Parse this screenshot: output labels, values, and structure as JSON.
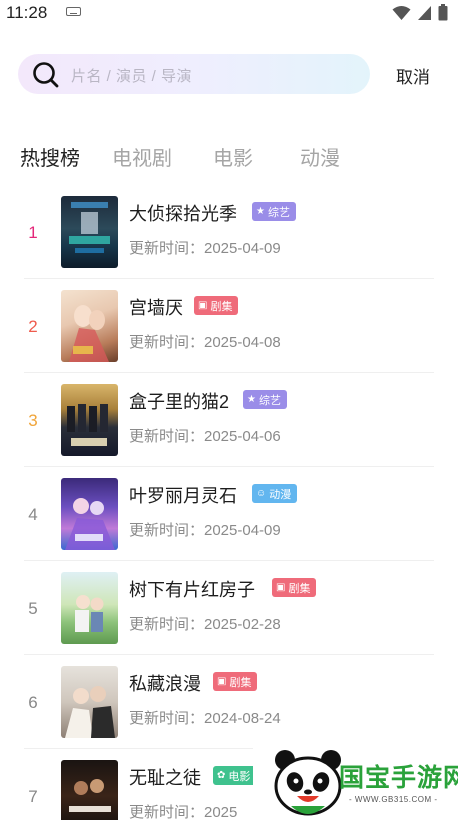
{
  "status_bar": {
    "time": "11:28",
    "icons": [
      "keyboard-icon",
      "wifi-icon",
      "signal-icon",
      "battery-icon"
    ]
  },
  "search": {
    "placeholder": "片名 / 演员 / 导演",
    "cancel_label": "取消"
  },
  "tabs": [
    {
      "label": "热搜榜",
      "active": true
    },
    {
      "label": "电视剧",
      "active": false
    },
    {
      "label": "电影",
      "active": false
    },
    {
      "label": "动漫",
      "active": false
    }
  ],
  "list": {
    "items": [
      {
        "rank": "1",
        "title": "大侦探拾光季",
        "tag": "综艺",
        "updated": "更新时间：2025-04-09"
      },
      {
        "rank": "2",
        "title": "宫墙厌",
        "tag": "剧集",
        "updated": "更新时间：2025-04-08"
      },
      {
        "rank": "3",
        "title": "盒子里的猫2",
        "tag": "综艺",
        "updated": "更新时间：2025-04-06"
      },
      {
        "rank": "4",
        "title": "叶罗丽月灵石",
        "tag": "动漫",
        "updated": "更新时间：2025-04-09"
      },
      {
        "rank": "5",
        "title": "树下有片红房子",
        "tag": "剧集",
        "updated": "更新时间：2025-02-28"
      },
      {
        "rank": "6",
        "title": "私藏浪漫",
        "tag": "剧集",
        "updated": "更新时间：2024-08-24"
      },
      {
        "rank": "7",
        "title": "无耻之徒",
        "tag": "电影",
        "updated": "更新时间：2025"
      }
    ]
  },
  "colors": {
    "rank_1": "#e4287a",
    "rank_2": "#ee5b4d",
    "rank_3": "#f0a53a",
    "rank_other": "#888888",
    "tag_variety": "#9a8de8",
    "tag_drama": "#ef6b7a",
    "tag_anime": "#62b6ef",
    "tag_movie": "#3fc28e"
  },
  "watermark": {
    "text": "国宝手游网",
    "url": "- WWW.GB315.COM -"
  }
}
